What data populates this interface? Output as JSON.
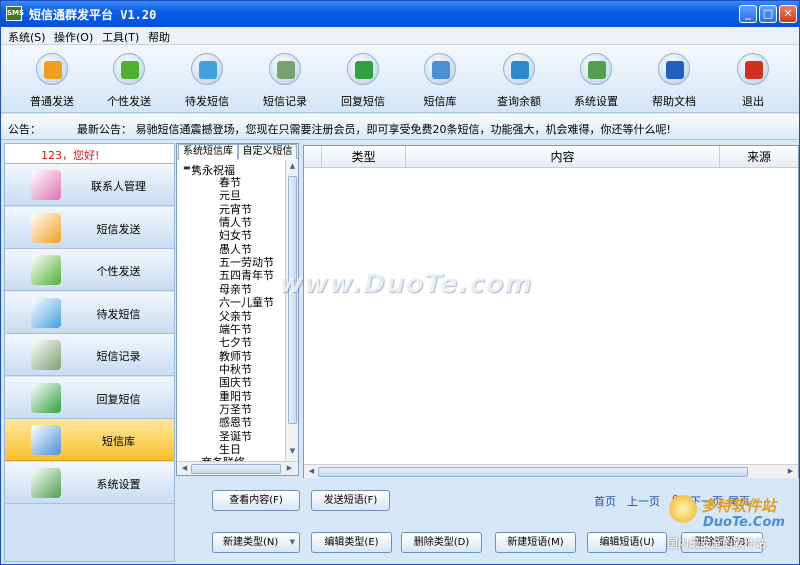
{
  "window": {
    "title": "短信通群发平台 V1.20",
    "app_icon_text": "SMS",
    "controls": {
      "minimize": "_",
      "maximize": "□",
      "close": "✕"
    }
  },
  "menu": [
    "系统(S)",
    "操作(O)",
    "工具(T)",
    "帮助"
  ],
  "toolbar": [
    {
      "label": "普通发送",
      "icon": "coins-icon",
      "color": "#f0a020"
    },
    {
      "label": "个性发送",
      "icon": "bag-icon",
      "color": "#50b030"
    },
    {
      "label": "待发短信",
      "icon": "envelope-icon",
      "color": "#40a0e0"
    },
    {
      "label": "短信记录",
      "icon": "records-icon",
      "color": "#7aa070"
    },
    {
      "label": "回复短信",
      "icon": "reply-icon",
      "color": "#30a040"
    },
    {
      "label": "短信库",
      "icon": "library-icon",
      "color": "#4a90d8"
    },
    {
      "label": "查询余额",
      "icon": "globe-icon",
      "color": "#2a8ad0"
    },
    {
      "label": "系统设置",
      "icon": "settings-icon",
      "color": "#50a050"
    },
    {
      "label": "帮助文档",
      "icon": "help-icon",
      "color": "#2060c0"
    },
    {
      "label": "退出",
      "icon": "exit-icon",
      "color": "#d03020"
    }
  ],
  "notice": {
    "label": "公告：",
    "text": "最新公告：  易驰短信通震撼登场，您现在只需要注册会员，即可享受免费20条短信，功能强大，机会难得，你还等什么呢!"
  },
  "sidebar": {
    "greeting": "123，您好!",
    "items": [
      {
        "label": "联系人管理",
        "icon": "contacts-icon",
        "color": "#e070b0",
        "active": false
      },
      {
        "label": "短信发送",
        "icon": "coins-icon",
        "color": "#f0a020",
        "active": false
      },
      {
        "label": "个性发送",
        "icon": "bag-icon",
        "color": "#50b030",
        "active": false
      },
      {
        "label": "待发短信",
        "icon": "envelope-icon",
        "color": "#40a0e0",
        "active": false
      },
      {
        "label": "短信记录",
        "icon": "records-icon",
        "color": "#7aa070",
        "active": false
      },
      {
        "label": "回复短信",
        "icon": "reply-icon",
        "color": "#30a040",
        "active": false
      },
      {
        "label": "短信库",
        "icon": "library-icon",
        "color": "#4a90d8",
        "active": true
      },
      {
        "label": "系统设置",
        "icon": "settings-icon",
        "color": "#50a050",
        "active": false
      }
    ]
  },
  "library": {
    "tabs": [
      "系统短信库",
      "自定义短信"
    ],
    "root": "隽永祝福",
    "toggle": "▬",
    "leaves": [
      "春节",
      "元旦",
      "元宵节",
      "情人节",
      "妇女节",
      "愚人节",
      "五一劳动节",
      "五四青年节",
      "母亲节",
      "六一儿童节",
      "父亲节",
      "端午节",
      "七夕节",
      "教师节",
      "中秋节",
      "国庆节",
      "重阳节",
      "万圣节",
      "感恩节",
      "圣诞节",
      "生日",
      "商务联络"
    ]
  },
  "grid": {
    "columns": [
      "类型",
      "内容",
      "来源"
    ]
  },
  "scroll": {
    "up": "▲",
    "down": "▼",
    "left": "◀",
    "right": "▶"
  },
  "buttons": {
    "view": "查看内容(F)",
    "send": "发送短语(F)",
    "new_type": "新建类型(N)",
    "new_type_arrow": "▼",
    "edit_type": "编辑类型(E)",
    "delete_type": "删除类型(D)",
    "new_phrase": "新建短语(M)",
    "edit_phrase": "编辑短语(U)",
    "delete_phrase": "删除短语(B)"
  },
  "pager": {
    "first": "首页",
    "prev": "上一页",
    "current": "0",
    "next": "下一页",
    "last": "尾页"
  },
  "watermarks": {
    "center": "www.DuoTe.com",
    "logo_main": "多特软件站",
    "logo_url": "DuoTe.Com",
    "logo_sub": "国内最安全的软件站"
  }
}
